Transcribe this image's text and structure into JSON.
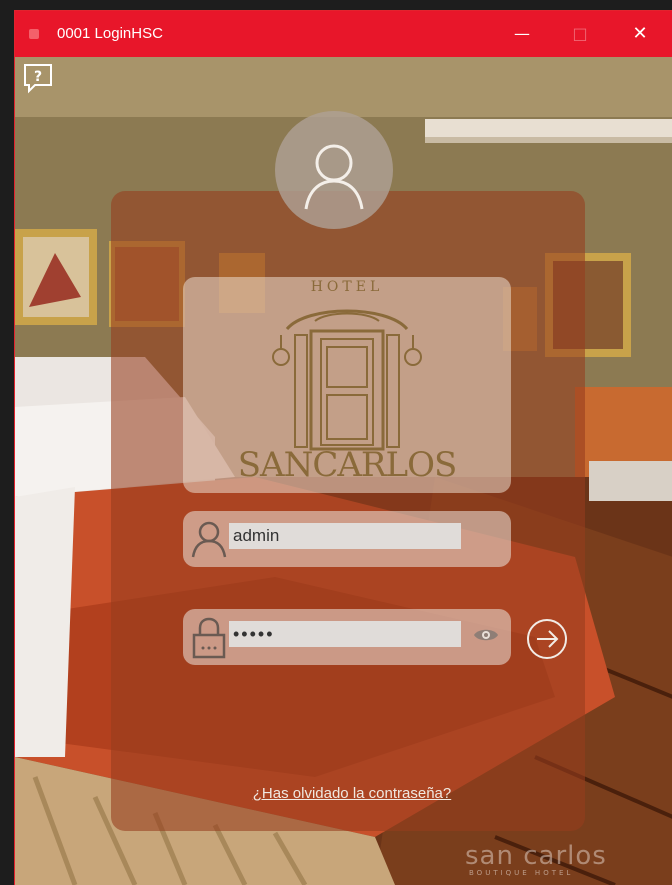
{
  "window": {
    "title": "0001 LoginHSC",
    "minimize_glyph": "—",
    "maximize_glyph": "□",
    "close_glyph": "✕"
  },
  "help": {
    "glyph": "?"
  },
  "logo": {
    "top_text": "HOTEL",
    "brand_text": "SANCARLOS"
  },
  "login": {
    "username_value": "admin",
    "password_value": "•••••",
    "forgot_link": "¿Has olvidado la contraseña?"
  },
  "footer_brand": {
    "name": "san carlos",
    "tagline": "BOUTIQUE HOTEL"
  },
  "colors": {
    "titlebar": "#e8162a",
    "panel": "#963c1e",
    "logo_gold": "#8a6a3a"
  }
}
